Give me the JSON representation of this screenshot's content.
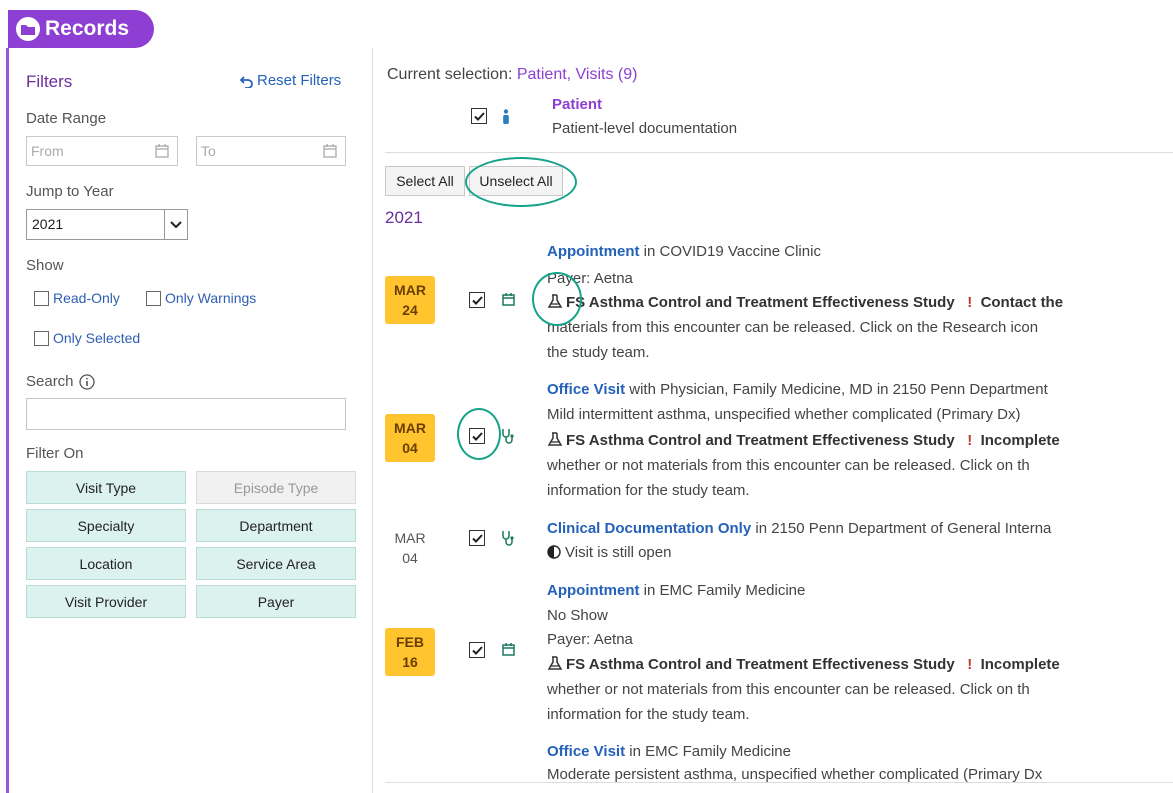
{
  "header": {
    "title": "Records",
    "accent": "#8c3fd2"
  },
  "filters": {
    "title": "Filters",
    "reset_label": "Reset Filters",
    "date_range_label": "Date Range",
    "from_placeholder": "From",
    "to_placeholder": "To",
    "jump_label": "Jump to Year",
    "year_value": "2021",
    "show_label": "Show",
    "read_only": "Read-Only",
    "only_warnings": "Only Warnings",
    "only_selected": "Only Selected",
    "search_label": "Search",
    "search_value": "",
    "filter_on_label": "Filter On",
    "buttons": {
      "visit_type": "Visit Type",
      "episode_type": "Episode Type",
      "specialty": "Specialty",
      "department": "Department",
      "location": "Location",
      "service_area": "Service Area",
      "visit_provider": "Visit Provider",
      "payer": "Payer"
    }
  },
  "main": {
    "current_selection_label": "Current selection:",
    "current_selection_value": "Patient, Visits (9)",
    "patient_title": "Patient",
    "patient_desc": "Patient-level documentation",
    "select_all": "Select All",
    "unselect_all": "Unselect All",
    "year": "2021",
    "encounters": [
      {
        "month": "MAR",
        "day": "24",
        "type": "Appointment",
        "type_suffix": " in COVID19 Vaccine Clinic",
        "payer": "Payer: Aetna",
        "study": "FS Asthma Control and Treatment Effectiveness Study",
        "warn": "Contact the",
        "cont1": "materials from this encounter can be released. Click on the Research icon",
        "cont2": "the study team."
      },
      {
        "month": "MAR",
        "day": "04",
        "type": "Office Visit",
        "type_suffix": " with Physician, Family Medicine, MD in 2150 Penn Department",
        "dx": "Mild intermittent asthma, unspecified whether complicated (Primary Dx)",
        "study": "FS Asthma Control and Treatment Effectiveness Study",
        "warn": "Incomplete",
        "cont1": "whether or not materials from this encounter can be released. Click on th",
        "cont2": "information for the study team."
      },
      {
        "month": "MAR",
        "day": "04",
        "type": "Clinical Documentation Only",
        "type_suffix": " in 2150 Penn Department of General Interna",
        "status": "Visit is still open"
      },
      {
        "month": "FEB",
        "day": "16",
        "type": "Appointment",
        "type_suffix": " in EMC Family Medicine",
        "noshow": "No Show",
        "payer": "Payer: Aetna",
        "study": "FS Asthma Control and Treatment Effectiveness Study",
        "warn": "Incomplete",
        "cont1": "whether or not materials from this encounter can be released. Click on th",
        "cont2": "information for the study team."
      },
      {
        "type": "Office Visit",
        "type_suffix": " in EMC Family Medicine",
        "dx": "Moderate persistent asthma, unspecified whether complicated (Primary Dx"
      }
    ]
  }
}
